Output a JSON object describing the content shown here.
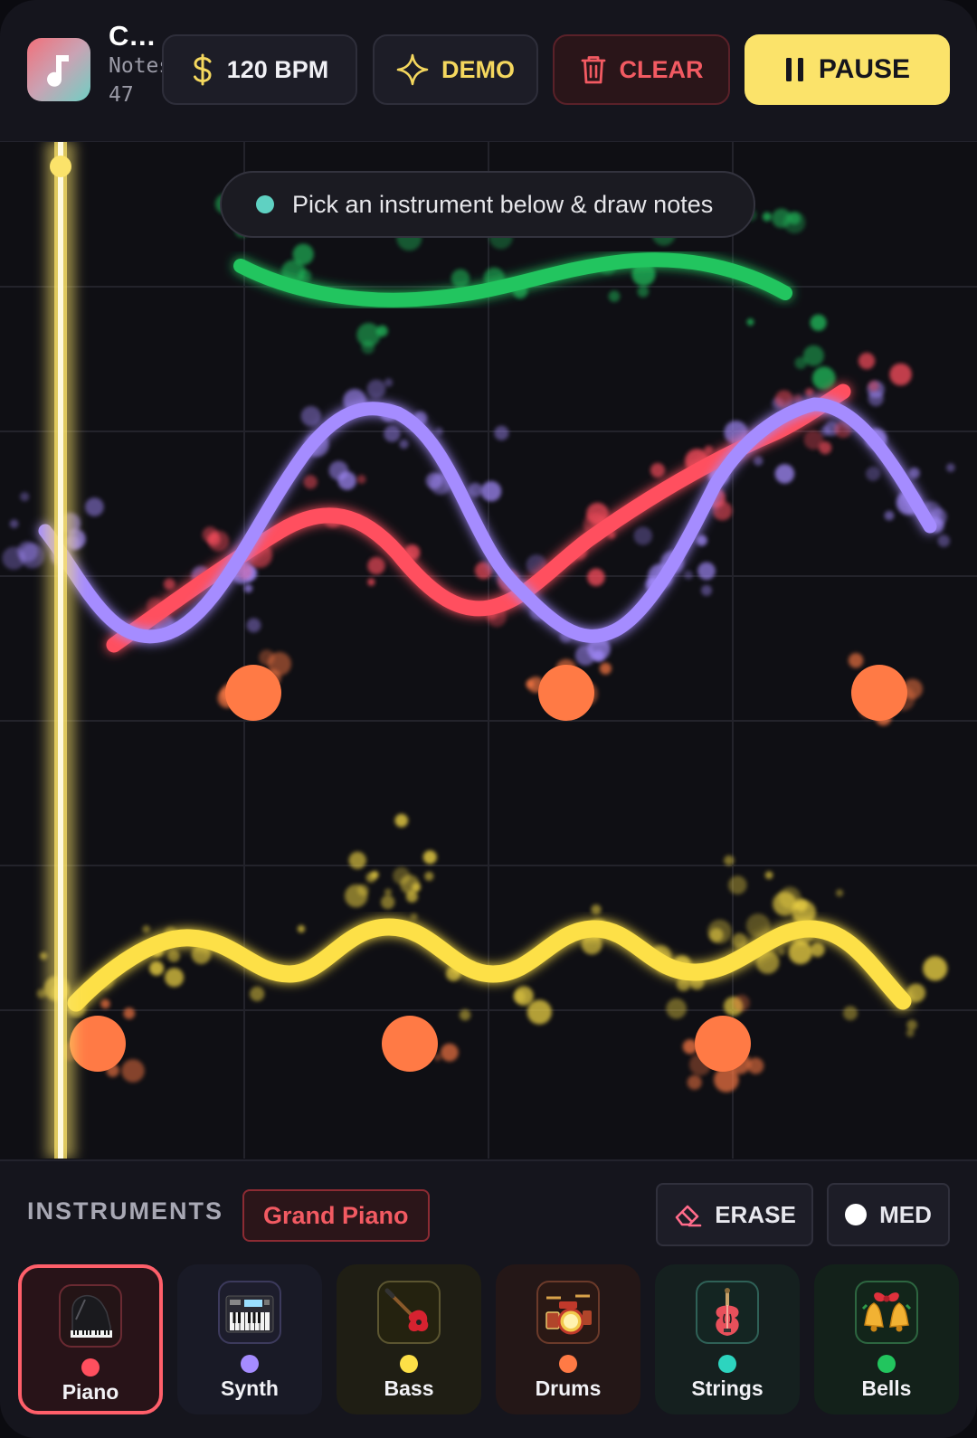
{
  "header": {
    "title": "C...",
    "notes_label": "Notes",
    "notes_count": "47",
    "app_icon": "music-note-icon",
    "bpm_label": "120 BPM",
    "demo_label": "DEMO",
    "clear_label": "CLEAR",
    "pause_label": "PAUSE"
  },
  "canvas": {
    "hint_text": "Pick an instrument below & draw notes",
    "playhead_color": "#fbe36a"
  },
  "strokes": [
    {
      "instrument": "Strings",
      "color": "#22c55e"
    },
    {
      "instrument": "Synth",
      "color": "#a58cff"
    },
    {
      "instrument": "Piano",
      "color": "#ff4f5e"
    },
    {
      "instrument": "Bass",
      "color": "#fde047"
    },
    {
      "instrument": "Drums",
      "color": "#ff7a45"
    }
  ],
  "panel": {
    "section_label": "INSTRUMENTS",
    "selected_instrument": "Grand Piano",
    "erase_label": "ERASE",
    "size_label": "MED",
    "instruments": [
      {
        "label": "Piano",
        "icon": "piano-icon",
        "color": "#ff4f5e",
        "selected": true
      },
      {
        "label": "Synth",
        "icon": "synth-keyboard-icon",
        "color": "#a58cff",
        "selected": false
      },
      {
        "label": "Bass",
        "icon": "bass-guitar-icon",
        "color": "#fde047",
        "selected": false
      },
      {
        "label": "Drums",
        "icon": "drum-kit-icon",
        "color": "#ff7a45",
        "selected": false
      },
      {
        "label": "Strings",
        "icon": "violin-icon",
        "color": "#2dd4bf",
        "selected": false
      },
      {
        "label": "Bells",
        "icon": "bells-icon",
        "color": "#22c55e",
        "selected": false
      }
    ]
  }
}
